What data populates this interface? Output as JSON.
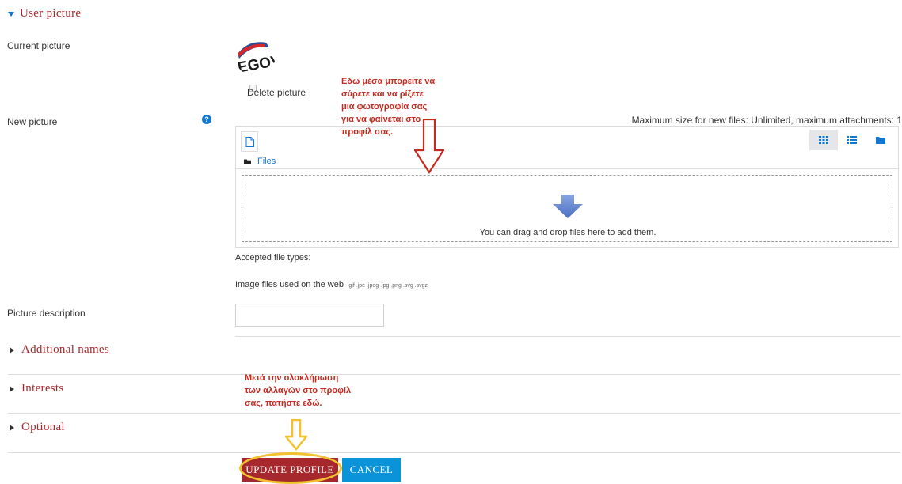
{
  "section_user_picture": {
    "title": "User picture"
  },
  "current_picture": {
    "label": "Current picture",
    "avatar_text": "EGOV",
    "delete_label": "Delete picture"
  },
  "new_picture": {
    "label": "New picture",
    "help_icon": "question-circle-icon",
    "max_size_text": "Maximum size for new files: Unlimited, maximum attachments: 1",
    "files_label": "Files",
    "dropzone_text": "You can drag and drop files here to add them.",
    "accepted_label": "Accepted file types:",
    "accepted_desc": "Image files used on the web",
    "accepted_exts": ".gif .jpe .jpeg .jpg .png .svg .svgz",
    "view_modes": [
      "grid-view-icon",
      "list-view-icon",
      "tree-view-icon"
    ]
  },
  "picture_description": {
    "label": "Picture description",
    "value": ""
  },
  "collapsed_sections": [
    {
      "title": "Additional names"
    },
    {
      "title": "Interests"
    },
    {
      "title": "Optional"
    }
  ],
  "annotations": {
    "dragdrop_note": [
      "Εδώ μέσα μπορείτε να",
      "σύρετε και να ρίξετε",
      "μια φωτογραφία σας",
      "για να φαίνεται στο",
      "προφίλ σας."
    ],
    "update_note": [
      "Μετά την ολοκλήρωση",
      "των αλλαγών στο προφίλ",
      "σας, πατήστε εδώ."
    ]
  },
  "buttons": {
    "update": "UPDATE PROFILE",
    "cancel": "CANCEL"
  },
  "colors": {
    "brand_red": "#a6272c",
    "link_blue": "#1177d1",
    "cancel_blue": "#0a93d9",
    "annotation_red": "#c62a1f",
    "highlight_yellow": "#f2c12e"
  }
}
